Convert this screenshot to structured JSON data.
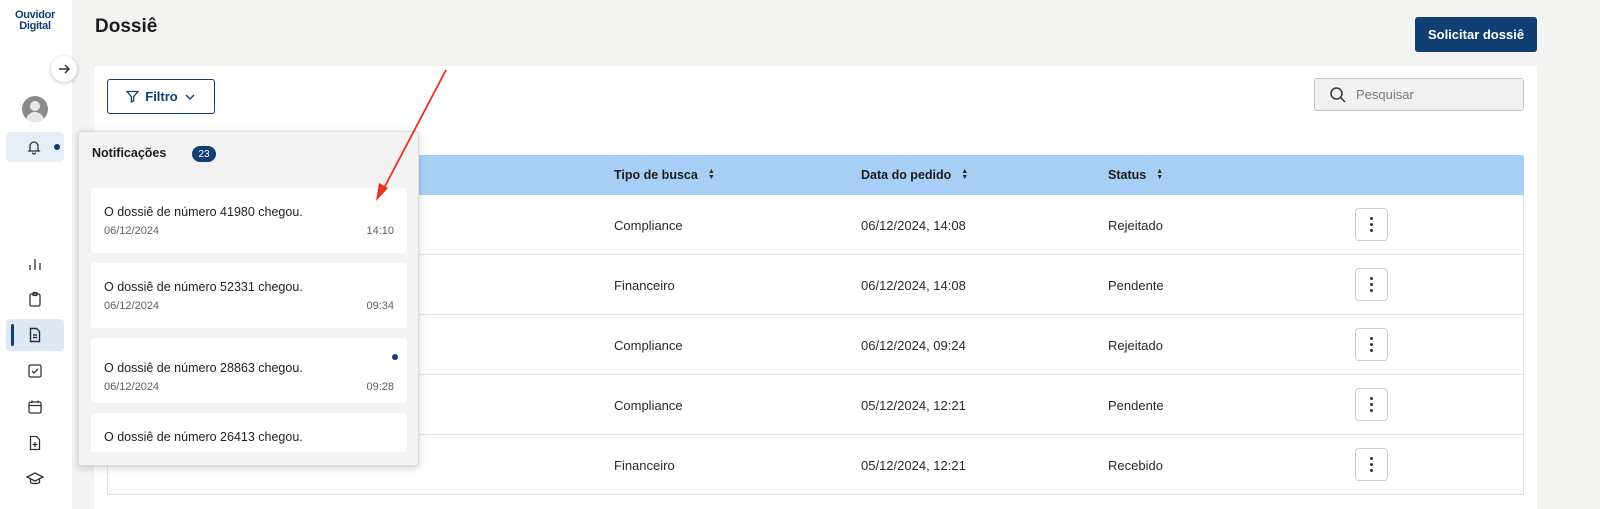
{
  "app": {
    "logo_line1": "Ouvidor",
    "logo_line2": "Digital"
  },
  "header": {
    "title": "Dossiê",
    "primary_button": "Solicitar dossiê"
  },
  "toolbar": {
    "filter_label": "Filtro",
    "search_placeholder": "Pesquisar"
  },
  "table": {
    "columns": [
      "Tipo de busca",
      "Data do pedido",
      "Status"
    ],
    "rows": [
      {
        "tipo": "Compliance",
        "data": "06/12/2024, 14:08",
        "status": "Rejeitado"
      },
      {
        "tipo": "Financeiro",
        "data": "06/12/2024, 14:08",
        "status": "Pendente"
      },
      {
        "tipo": "Compliance",
        "data": "06/12/2024, 09:24",
        "status": "Rejeitado"
      },
      {
        "tipo": "Compliance",
        "data": "05/12/2024, 12:21",
        "status": "Pendente"
      },
      {
        "tipo": "Financeiro",
        "data": "05/12/2024, 12:21",
        "status": "Recebido"
      }
    ]
  },
  "notifications": {
    "title": "Notificações",
    "count": "23",
    "items": [
      {
        "message": "O dossiê de número 41980 chegou.",
        "date": "06/12/2024",
        "time": "14:10",
        "unread": false
      },
      {
        "message": "O dossiê de número 52331 chegou.",
        "date": "06/12/2024",
        "time": "09:34",
        "unread": false
      },
      {
        "message": "O dossiê de número 28863 chegou.",
        "date": "06/12/2024",
        "time": "09:28",
        "unread": true
      },
      {
        "message": "O dossiê de número 26413 chegou.",
        "date": "",
        "time": "",
        "unread": false
      }
    ]
  },
  "sidebar": {
    "icons": [
      "chart-icon",
      "clipboard-icon",
      "document-icon",
      "checklist-icon",
      "calendar-icon",
      "add-file-icon",
      "graduation-cap-icon"
    ],
    "active": "document-icon"
  },
  "colors": {
    "brand": "#123f73",
    "table_header": "#a7cff5",
    "annotation_arrow": "#e8311f"
  }
}
